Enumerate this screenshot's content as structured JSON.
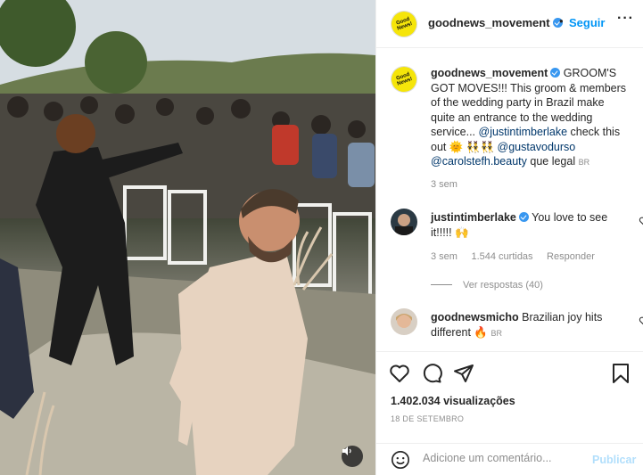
{
  "colors": {
    "accent": "#0095f6",
    "verified": "#3897f0",
    "logo_yellow": "#f5e50a",
    "muted": "#8e8e8e"
  },
  "media": {
    "mute_icon": "speaker-icon"
  },
  "header": {
    "logo_text": "Good News!",
    "username": "goodnews_movement",
    "separator": "•",
    "follow_label": "Seguir",
    "more_icon": "more-horizontal-icon"
  },
  "caption": {
    "logo_text": "Good News!",
    "username": "goodnews_movement",
    "text_1": "GROOM'S GOT MOVES!!! This groom & members of the wedding party in Brazil make quite an entrance to the wedding service... ",
    "mention_1": "@justintimberlake",
    "text_2": " check this out 🌞 👯‍♂️👯‍♂️ ",
    "mention_2": "@gustavodurso",
    "mention_3": "@carolstefh.beauty",
    "text_3": " que legal",
    "tag": "BR",
    "time": "3 sem"
  },
  "comments": [
    {
      "username": "justintimberlake",
      "text": "You love to see it!!!!! 🙌",
      "time": "3 sem",
      "likes": "1.544 curtidas",
      "reply_label": "Responder",
      "view_replies": "Ver respostas (40)"
    },
    {
      "username": "goodnewsmicho",
      "text": "Brazilian joy hits different 🔥",
      "tag": "BR"
    }
  ],
  "actions": {
    "like_icon": "heart-icon",
    "comment_icon": "comment-icon",
    "share_icon": "share-icon",
    "save_icon": "bookmark-icon",
    "views": "1.402.034 visualizações",
    "date": "18 DE SETEMBRO"
  },
  "add_comment": {
    "emoji_icon": "emoji-icon",
    "placeholder": "Adicione um comentário...",
    "publish_label": "Publicar"
  }
}
